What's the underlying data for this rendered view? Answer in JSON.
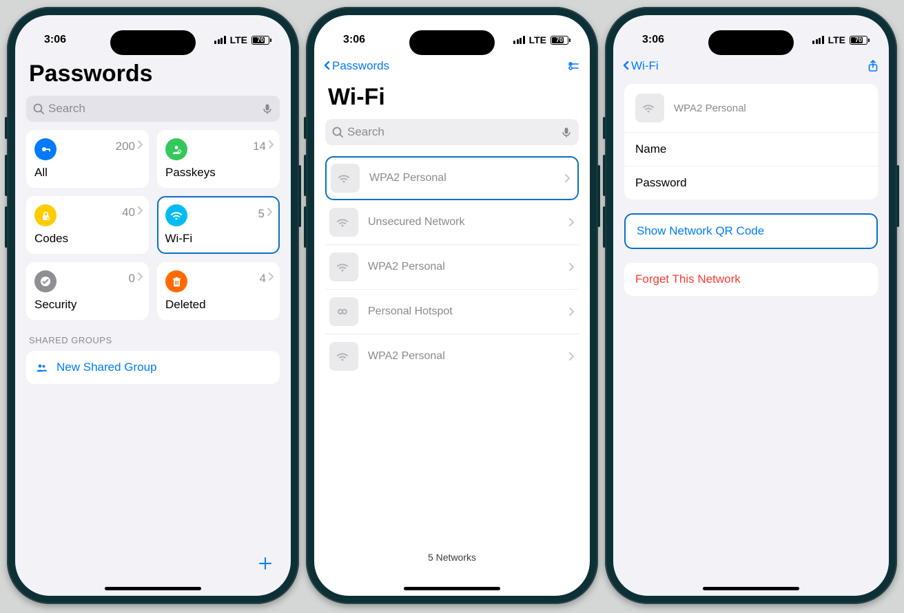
{
  "status": {
    "time": "3:06",
    "carrier": "LTE",
    "battery": "70"
  },
  "screen1": {
    "title": "Passwords",
    "search_placeholder": "Search",
    "tiles": [
      {
        "id": "all",
        "label": "All",
        "count": "200",
        "color": "#007aff"
      },
      {
        "id": "passkeys",
        "label": "Passkeys",
        "count": "14",
        "color": "#34c759"
      },
      {
        "id": "codes",
        "label": "Codes",
        "count": "40",
        "color": "#ffcc00"
      },
      {
        "id": "wifi",
        "label": "Wi-Fi",
        "count": "5",
        "color": "#00bcf2",
        "selected": true
      },
      {
        "id": "security",
        "label": "Security",
        "count": "0",
        "color": "#8e8e93"
      },
      {
        "id": "deleted",
        "label": "Deleted",
        "count": "4",
        "color": "#ff6b00"
      }
    ],
    "shared_header": "SHARED GROUPS",
    "new_group_label": "New Shared Group"
  },
  "screen2": {
    "back_label": "Passwords",
    "title": "Wi-Fi",
    "search_placeholder": "Search",
    "networks": [
      {
        "name": "WPA2 Personal",
        "icon": "wifi",
        "selected": true
      },
      {
        "name": "Unsecured Network",
        "icon": "wifi"
      },
      {
        "name": "WPA2 Personal",
        "icon": "wifi"
      },
      {
        "name": "Personal Hotspot",
        "icon": "hotspot"
      },
      {
        "name": "WPA2 Personal",
        "icon": "wifi"
      }
    ],
    "footer": "5 Networks"
  },
  "screen3": {
    "back_label": "Wi-Fi",
    "network_type": "WPA2 Personal",
    "field_name": "Name",
    "field_password": "Password",
    "qr_label": "Show Network QR Code",
    "forget_label": "Forget This Network"
  }
}
